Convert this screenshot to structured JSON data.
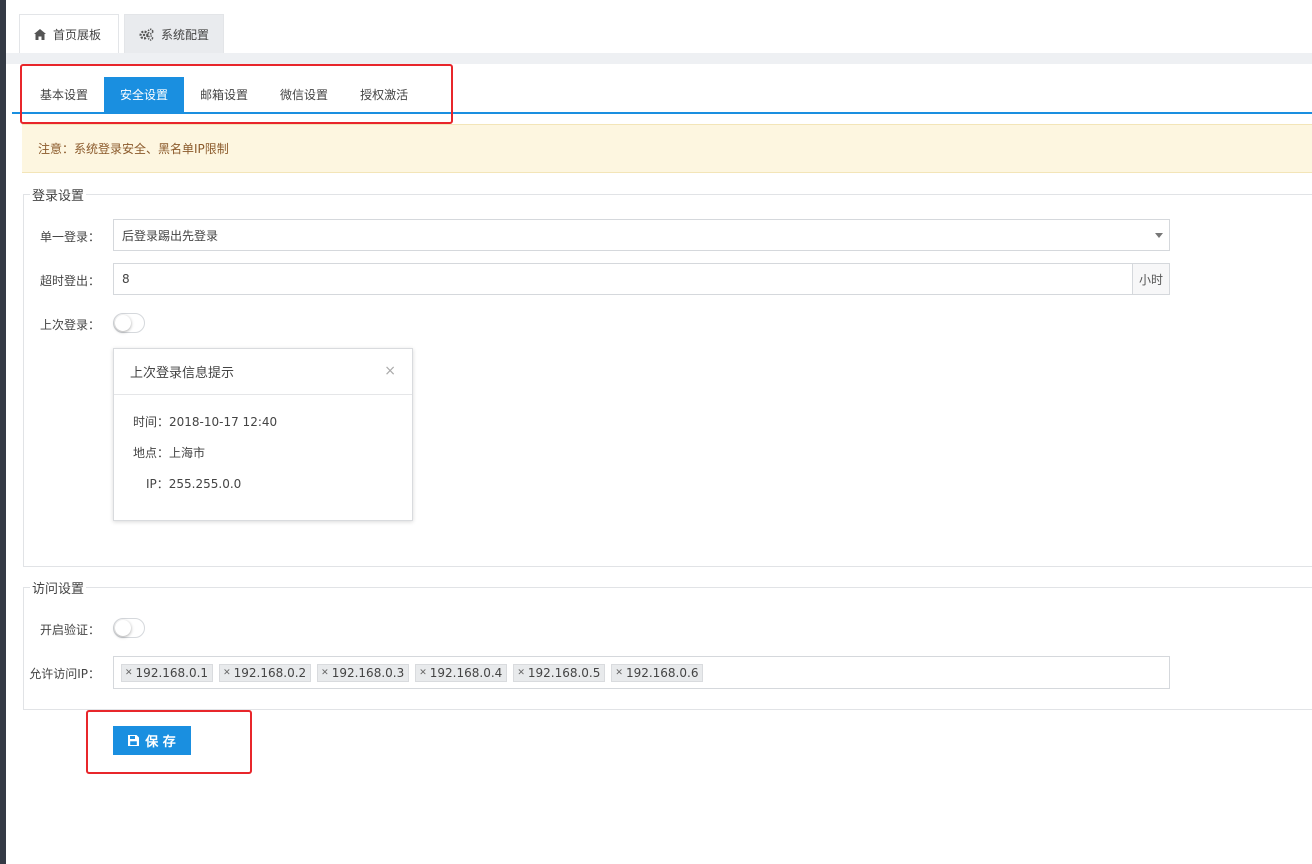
{
  "page_tabs": [
    {
      "label": "首页展板",
      "icon": "home-icon"
    },
    {
      "label": "系统配置",
      "icon": "gears-icon"
    }
  ],
  "sub_tabs": [
    "基本设置",
    "安全设置",
    "邮箱设置",
    "微信设置",
    "授权激活"
  ],
  "active_sub_tab": "安全设置",
  "notice": "注意：系统登录安全、黑名单IP限制",
  "login_settings": {
    "legend": "登录设置",
    "single_login_label": "单一登录：",
    "single_login_value": "后登录踢出先登录",
    "timeout_label": "超时登出：",
    "timeout_value": "8",
    "timeout_unit": "小时",
    "last_login_label": "上次登录：",
    "last_login_enabled": false,
    "popup": {
      "title": "上次登录信息提示",
      "close": "×",
      "time": "时间：2018-10-17 12:40",
      "location": "地点：上海市",
      "ip": "IP：255.255.0.0"
    }
  },
  "access_settings": {
    "legend": "访问设置",
    "verify_label": "开启验证：",
    "verify_enabled": false,
    "allowed_ip_label": "允许访问IP：",
    "allowed_ips": [
      "192.168.0.1",
      "192.168.0.2",
      "192.168.0.3",
      "192.168.0.4",
      "192.168.0.5",
      "192.168.0.6"
    ]
  },
  "save_label": "保 存",
  "colors": {
    "accent": "#1a8fe0",
    "highlight": "#e8262b",
    "notice_bg": "#fdf6e0"
  }
}
